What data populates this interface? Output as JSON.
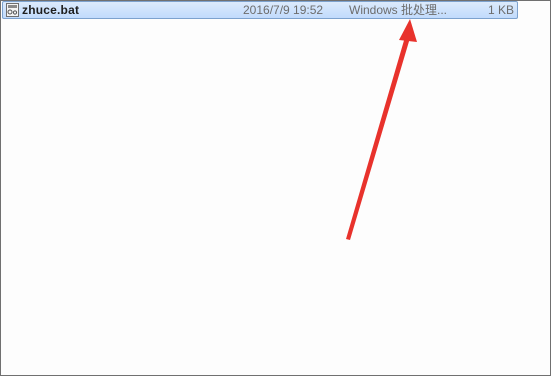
{
  "file_row": {
    "name": "zhuce.bat",
    "date_modified": "2016/7/9 19:52",
    "type": "Windows 批处理...",
    "size": "1 KB",
    "icon": "batch-file-icon"
  },
  "colors": {
    "selection_border": "#7da2ce",
    "selection_fill": "#c1dbfc",
    "arrow": "#e8322c"
  }
}
